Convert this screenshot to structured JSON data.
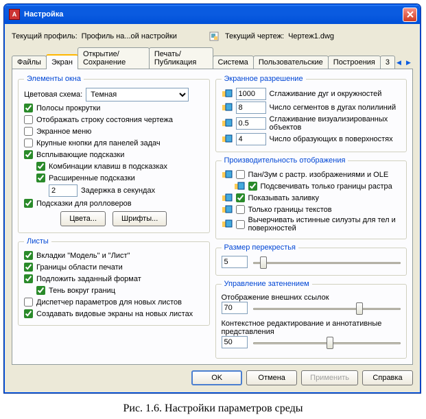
{
  "window": {
    "title": "Настройка"
  },
  "profile": {
    "current_profile_label": "Текущий профиль:",
    "current_profile_value": "Профиль на...ой настройки",
    "current_drawing_label": "Текущий чертеж:",
    "current_drawing_value": "Чертеж1.dwg"
  },
  "tabs": {
    "files": "Файлы",
    "screen": "Экран",
    "open_save": "Открытие/Сохранение",
    "print": "Печать/Публикация",
    "system": "Система",
    "user": "Пользовательские",
    "drafting": "Построения",
    "threed": "3"
  },
  "elements": {
    "legend": "Элементы окна",
    "color_scheme_label": "Цветовая схема:",
    "color_scheme_value": "Темная",
    "scrollbars": "Полосы прокрутки",
    "status_bar": "Отображать строку состояния чертежа",
    "screen_menu": "Экранное меню",
    "large_buttons": "Крупные кнопки для панелей задач",
    "tooltips": "Всплывающие подсказки",
    "shortcut_keys": "Комбинации клавиш в подсказках",
    "extended_tips": "Расширенные подсказки",
    "delay_value": "2",
    "delay_label": "Задержка в секундах",
    "rollover_tips": "Подсказки для ролловеров",
    "colors_btn": "Цвета...",
    "fonts_btn": "Шрифты..."
  },
  "layouts": {
    "legend": "Листы",
    "model_layout_tabs": "Вкладки \"Модель\" и \"Лист\"",
    "print_area": "Границы области печати",
    "paper_bg": "Подложить заданный формат",
    "shadow": "Тень вокруг границ",
    "page_setup_mgr": "Диспетчер параметров для новых листов",
    "create_viewports": "Создавать видовые экраны на новых листах"
  },
  "resolution": {
    "legend": "Экранное разрешение",
    "arc_smooth_value": "1000",
    "arc_smooth_label": "Сглаживание дуг и окружностей",
    "poly_seg_value": "8",
    "poly_seg_label": "Число сегментов в дугах полилиний",
    "render_smooth_value": "0.5",
    "render_smooth_label": "Сглаживание визуализированных объектов",
    "surf_contour_value": "4",
    "surf_contour_label": "Число образующих в поверхностях"
  },
  "performance": {
    "legend": "Производительность отображения",
    "pan_zoom": "Пан/Зум с растр. изображениями и OLE",
    "highlight_raster": "Подсвечивать только границы растра",
    "apply_fill": "Показывать заливку",
    "text_frame": "Только границы текстов",
    "true_silhouettes": "Вычерчивать истинные силуэты для тел и поверхностей"
  },
  "crosshair": {
    "legend": "Размер перекрестья",
    "value": "5"
  },
  "fade": {
    "legend": "Управление затенением",
    "xref_label": "Отображение внешних ссылок",
    "xref_value": "70",
    "inplace_label": "Контекстное редактирование и аннотативные представления",
    "inplace_value": "50"
  },
  "buttons": {
    "ok": "OK",
    "cancel": "Отмена",
    "apply": "Применить",
    "help": "Справка"
  },
  "caption": "Рис. 1.6. Настройки параметров среды"
}
